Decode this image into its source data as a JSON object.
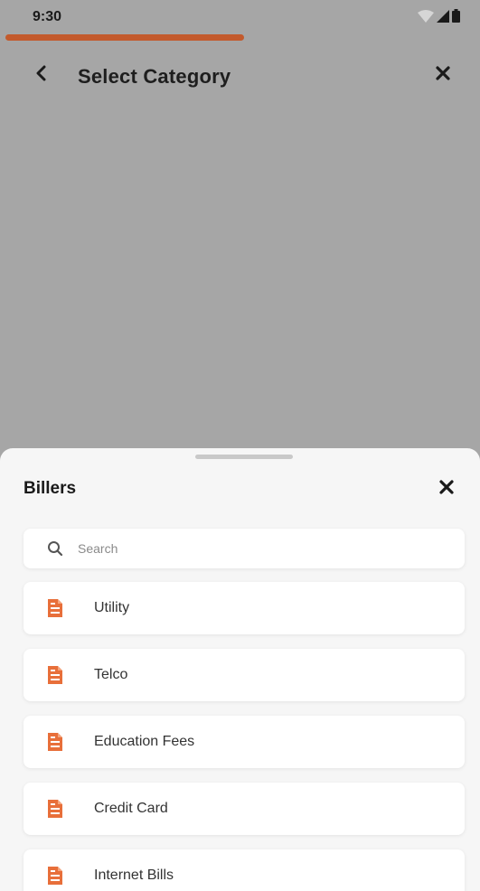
{
  "colors": {
    "accent": "#e86f3a",
    "progress": "#c35a2c",
    "overlay_bg": "#a6a6a6",
    "sheet_bg": "#f6f6f6"
  },
  "status_bar": {
    "time": "9:30",
    "icons": [
      "wifi-icon",
      "signal-icon",
      "battery-icon"
    ],
    "progress_fraction": 1.0
  },
  "header": {
    "title": "Select Category",
    "back_icon": "chevron-left-icon",
    "close_icon": "close-icon"
  },
  "sheet": {
    "title": "Billers",
    "close_icon": "close-icon",
    "search": {
      "placeholder": "Search",
      "value": "",
      "icon": "search-icon"
    },
    "categories": [
      {
        "label": "Utility",
        "icon": "bill-document-icon"
      },
      {
        "label": "Telco",
        "icon": "bill-document-icon"
      },
      {
        "label": "Education Fees",
        "icon": "bill-document-icon"
      },
      {
        "label": "Credit Card",
        "icon": "bill-document-icon"
      },
      {
        "label": "Internet Bills",
        "icon": "bill-document-icon"
      }
    ]
  }
}
